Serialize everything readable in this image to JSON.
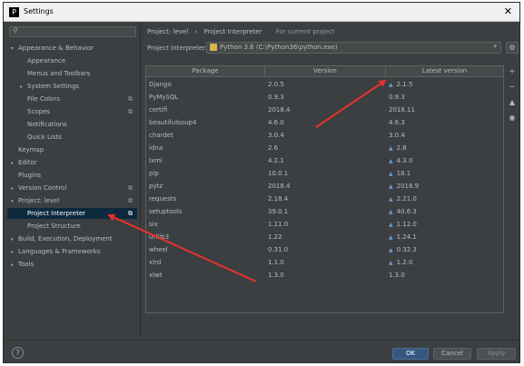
{
  "window": {
    "title": "Settings",
    "close_glyph": "✕"
  },
  "search": {
    "icon": "search-icon"
  },
  "sidebar": {
    "items": [
      {
        "label": "Appearance & Behavior",
        "expanded": true
      },
      {
        "label": "Appearance"
      },
      {
        "label": "Menus and Toolbars"
      },
      {
        "label": "System Settings",
        "expanded": false
      },
      {
        "label": "File Colors"
      },
      {
        "label": "Scopes"
      },
      {
        "label": "Notifications"
      },
      {
        "label": "Quick Lists"
      },
      {
        "label": "Keymap"
      },
      {
        "label": "Editor",
        "expanded": false
      },
      {
        "label": "Plugins"
      },
      {
        "label": "Version Control",
        "expanded": false
      },
      {
        "label": "Project: level",
        "expanded": true
      },
      {
        "label": "Project Interpreter",
        "selected": true
      },
      {
        "label": "Project Structure"
      },
      {
        "label": "Build, Execution, Deployment",
        "expanded": false
      },
      {
        "label": "Languages & Frameworks",
        "expanded": false
      },
      {
        "label": "Tools",
        "expanded": false
      }
    ]
  },
  "breadcrumb": {
    "parts": [
      "Project: level",
      "›",
      "Project Interpreter"
    ],
    "note": "For current project"
  },
  "interpreter": {
    "label": "Project Interpreter:",
    "value": "Python 3.6 (C:\\Python36\\python.exe)"
  },
  "packages": {
    "headers": [
      "Package",
      "Version",
      "Latest version"
    ],
    "rows": [
      {
        "package": "Django",
        "version": "2.0.5",
        "latest": "2.1.5",
        "update": true
      },
      {
        "package": "PyMySQL",
        "version": "0.9.3",
        "latest": "0.9.3",
        "update": false
      },
      {
        "package": "certifi",
        "version": "2018.4",
        "latest": "2018.11",
        "update": false
      },
      {
        "package": "beautifulsoup4",
        "version": "4.6.0",
        "latest": "4.6.3",
        "update": false
      },
      {
        "package": "chardet",
        "version": "3.0.4",
        "latest": "3.0.4",
        "update": false
      },
      {
        "package": "idna",
        "version": "2.6",
        "latest": "2.8",
        "update": true
      },
      {
        "package": "lxml",
        "version": "4.2.1",
        "latest": "4.3.0",
        "update": true
      },
      {
        "package": "pip",
        "version": "10.0.1",
        "latest": "18.1",
        "update": true
      },
      {
        "package": "pytz",
        "version": "2018.4",
        "latest": "2018.9",
        "update": true
      },
      {
        "package": "requests",
        "version": "2.18.4",
        "latest": "2.21.0",
        "update": true
      },
      {
        "package": "setuptools",
        "version": "39.0.1",
        "latest": "40.6.3",
        "update": true
      },
      {
        "package": "six",
        "version": "1.11.0",
        "latest": "1.12.0",
        "update": true
      },
      {
        "package": "urllib3",
        "version": "1.22",
        "latest": "1.24.1",
        "update": true
      },
      {
        "package": "wheel",
        "version": "0.31.0",
        "latest": "0.32.3",
        "update": true
      },
      {
        "package": "xlrd",
        "version": "1.1.0",
        "latest": "1.2.0",
        "update": true
      },
      {
        "package": "xlwt",
        "version": "1.3.0",
        "latest": "1.3.0",
        "update": false
      }
    ]
  },
  "side_tools": [
    {
      "glyph": "+",
      "icon": "add-icon"
    },
    {
      "glyph": "−",
      "icon": "remove-icon"
    },
    {
      "glyph": "▲",
      "icon": "upgrade-icon"
    },
    {
      "glyph": "◉",
      "icon": "show-early-releases-icon"
    }
  ],
  "buttons": {
    "help": "?",
    "ok": "OK",
    "cancel": "Cancel",
    "apply": "Apply"
  },
  "colors": {
    "background": "#3c3f41",
    "selection": "#0d293e",
    "ok_button": "#365880",
    "annotation_arrow": "#e8322b",
    "update_arrow": "#6b9bd1"
  }
}
